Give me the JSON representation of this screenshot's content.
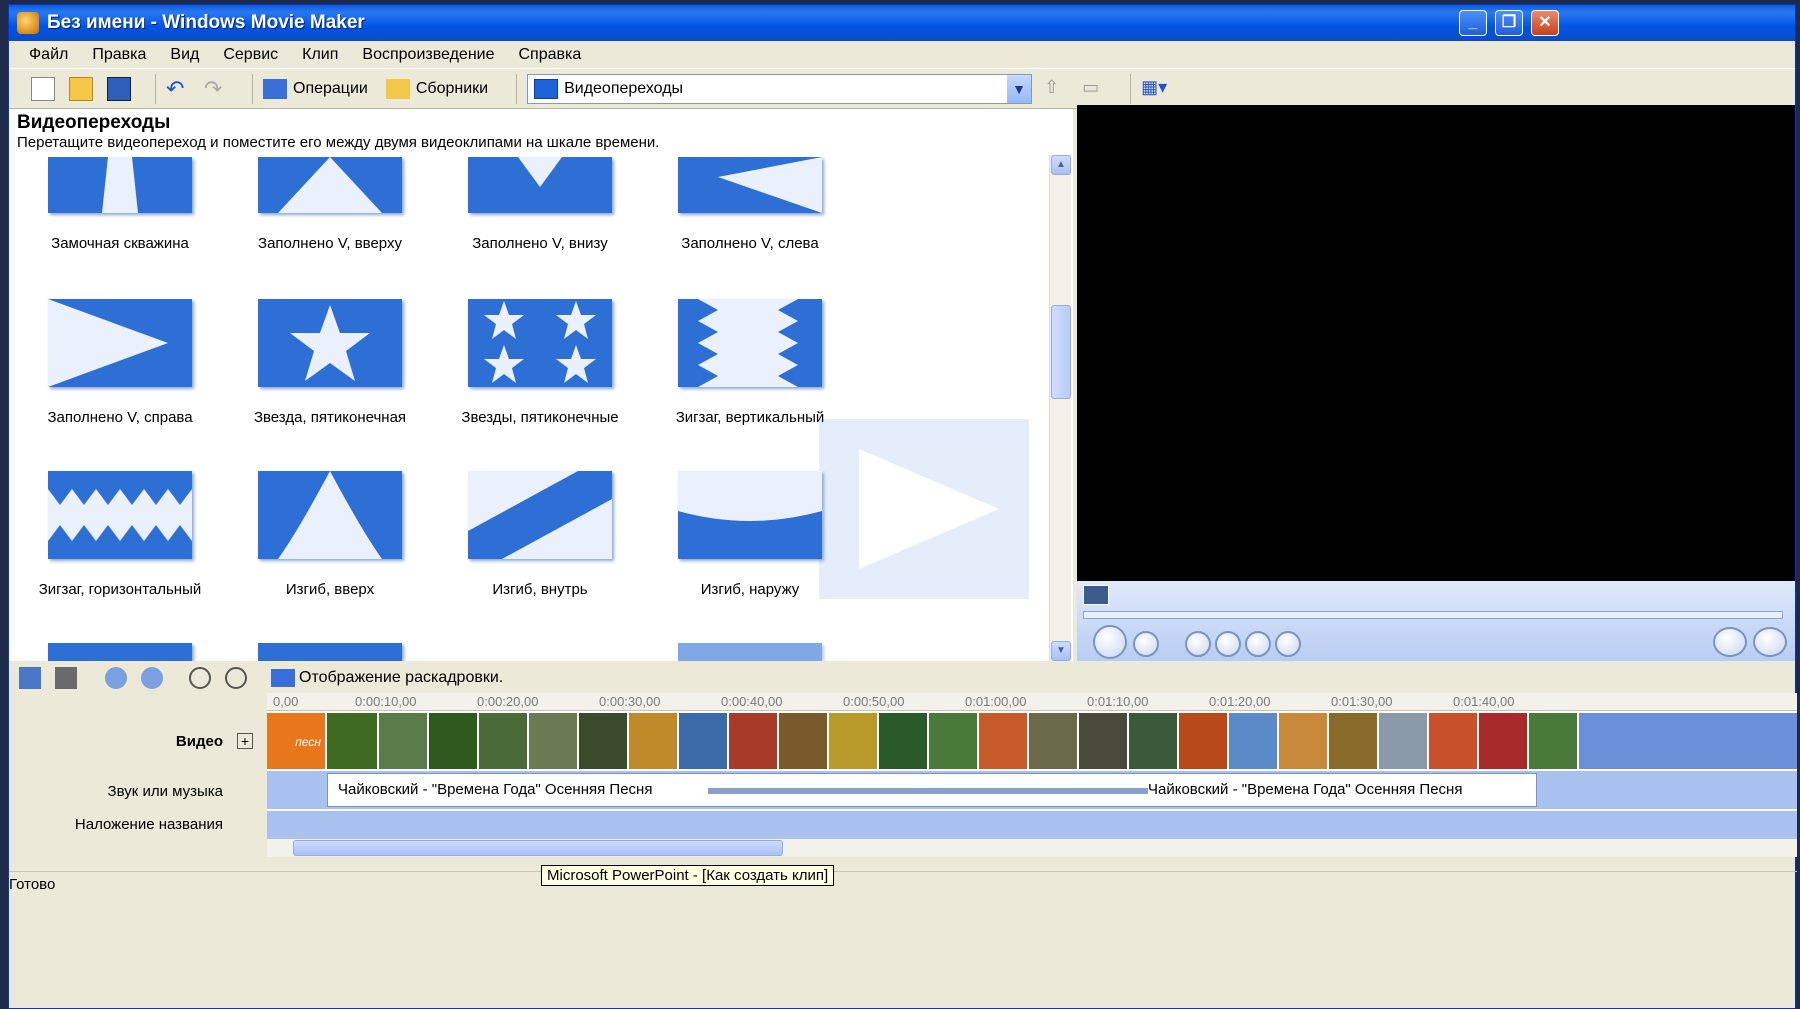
{
  "window": {
    "title": "Без имени - Windows Movie Maker"
  },
  "menu": [
    "Файл",
    "Правка",
    "Вид",
    "Сервис",
    "Клип",
    "Воспроизведение",
    "Справка"
  ],
  "toolbar": {
    "operations": "Операции",
    "collections": "Сборники",
    "combo_value": "Видеопереходы"
  },
  "pane": {
    "title": "Видеопереходы",
    "subtitle": "Перетащите видеопереход и поместите его между двумя видеоклипами на шкале времени.",
    "transitions": [
      "Замочная скважина",
      "Заполнено V, вверху",
      "Заполнено V, внизу",
      "Заполнено V, слева",
      "Заполнено V, справа",
      "Звезда, пятиконечная",
      "Звезды, пятиконечные",
      "Зигзаг, вертикальный",
      "Зигзаг, горизонтальный",
      "Изгиб, вверх",
      "Изгиб, внутрь",
      "Изгиб, наружу"
    ]
  },
  "timeline": {
    "storyboard_label": "Отображение раскадровки.",
    "ruler": [
      "0,00",
      "0:00:10,00",
      "0:00:20,00",
      "0:00:30,00",
      "0:00:40,00",
      "0:00:50,00",
      "0:01:00,00",
      "0:01:10,00",
      "0:01:20,00",
      "0:01:30,00",
      "0:01:40,00"
    ],
    "tracks": {
      "video": "Видео",
      "audio": "Звук или музыка",
      "title": "Наложение названия"
    },
    "audio_clip_a": "Чайковский - \"Времена Года\" Осенняя Песня",
    "audio_clip_b": "Чайковский - \"Времена Года\" Осенняя Песня",
    "first_clip_text": "песн"
  },
  "status": {
    "text": "Готово",
    "tooltip": "Microsoft PowerPoint - [Как создать клип]"
  },
  "colors": {
    "titlebar": "#0054e3",
    "tile": "#2d6fd4",
    "timeline_track": "#a8c1ef"
  }
}
